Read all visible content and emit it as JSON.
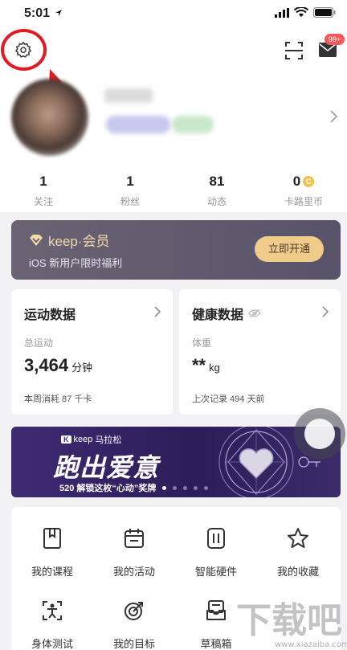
{
  "status_bar": {
    "time": "5:01"
  },
  "header": {
    "badge": "99+"
  },
  "stats": [
    {
      "value": "1",
      "label": "关注"
    },
    {
      "value": "1",
      "label": "粉丝"
    },
    {
      "value": "81",
      "label": "动态"
    },
    {
      "value": "0",
      "label": "卡路里币"
    }
  ],
  "member": {
    "logo_text": "keep·会员",
    "subtitle": "iOS 新用户限时福利",
    "button": "立即开通"
  },
  "sport_card": {
    "title": "运动数据",
    "label": "总运动",
    "value": "3,464",
    "unit": "分钟",
    "footer": "本周消耗 87 千卡"
  },
  "health_card": {
    "title": "健康数据",
    "label": "体重",
    "value": "**",
    "unit": "kg",
    "footer": "上次记录 494 天前"
  },
  "banner": {
    "brand": "keep",
    "brand_suffix": "马拉松",
    "headline": "跑出爱意",
    "subtitle": "520 解锁这枚“心动”奖牌",
    "page_count": 5,
    "active_page": 1
  },
  "grid": [
    {
      "label": "我的课程",
      "icon": "bookmark-book-icon"
    },
    {
      "label": "我的活动",
      "icon": "calendar-icon"
    },
    {
      "label": "智能硬件",
      "icon": "smart-device-icon"
    },
    {
      "label": "我的收藏",
      "icon": "star-icon"
    },
    {
      "label": "身体测试",
      "icon": "body-test-icon"
    },
    {
      "label": "我的目标",
      "icon": "target-icon"
    },
    {
      "label": "草稿箱",
      "icon": "drafts-icon"
    }
  ],
  "watermark": {
    "text": "下载吧",
    "url": "www.xiazaiba.com"
  },
  "colors": {
    "accent_red": "#e21b23",
    "member_gold": "#f1cb8a",
    "badge_red": "#f05a5a",
    "banner_purple": "#3f2b73"
  }
}
